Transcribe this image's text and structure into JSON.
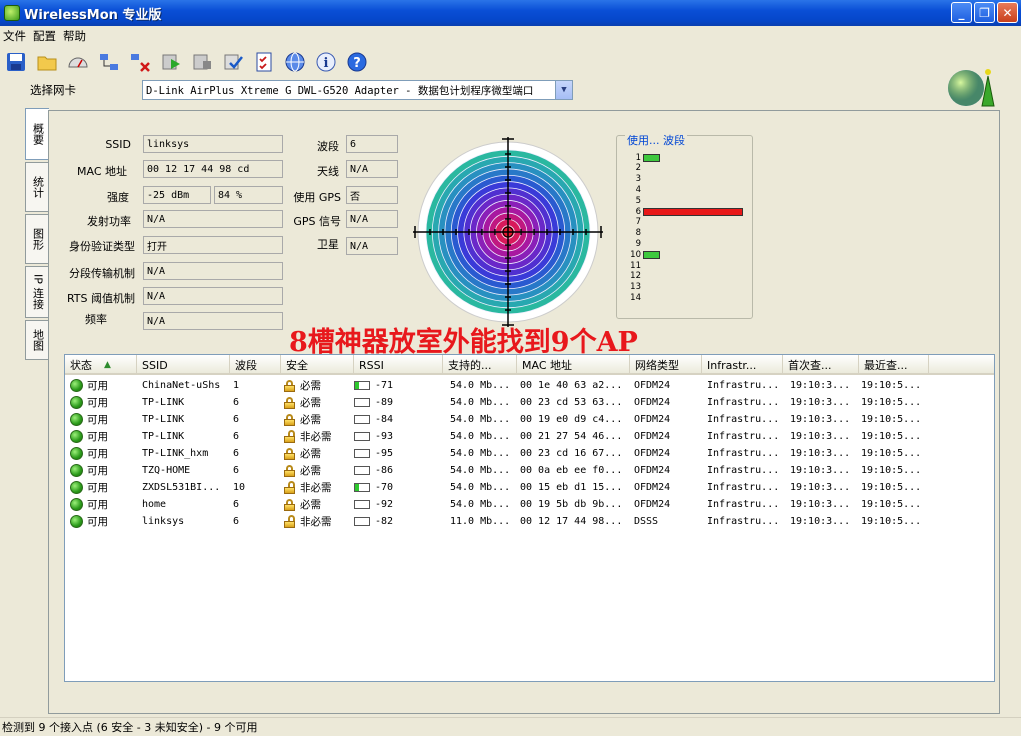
{
  "window": {
    "title": "WirelessMon 专业版"
  },
  "menu": [
    "文件",
    "配置",
    "帮助"
  ],
  "toolbar": [
    "save-icon",
    "open-folder-icon",
    "speedometer-icon",
    "network-icon",
    "disconnect-icon",
    "run-icon",
    "stop-icon",
    "check-icon",
    "checklist-icon",
    "globe-icon",
    "info-icon",
    "help-icon"
  ],
  "adapter": {
    "label": "选择网卡",
    "value": "D-Link AirPlus Xtreme G DWL-G520 Adapter - 数据包计划程序微型端口"
  },
  "tabs": [
    "概要",
    "统计",
    "图形",
    "IP 连接",
    "地图"
  ],
  "summary": {
    "ssid_label": "SSID",
    "ssid": "linksys",
    "mac_label": "MAC 地址",
    "mac": "00 12 17 44 98 cd",
    "strength_label": "强度",
    "strength_dbm": "-25 dBm",
    "strength_pct": "84 %",
    "tx_label": "发射功率",
    "tx": "N/A",
    "auth_label": "身份验证类型",
    "auth": "打开",
    "frag_label": "分段传输机制",
    "frag": "N/A",
    "rts_label": "RTS 阈值机制",
    "rts": "N/A",
    "freq_label": "频率",
    "freq": "N/A",
    "channel_label": "波段",
    "channel": "6",
    "antenna_label": "天线",
    "antenna": "N/A",
    "gps_label": "使用 GPS",
    "gps": "否",
    "gps_signal_label": "GPS 信号",
    "gps_signal": "N/A",
    "satellite_label": "卫星",
    "satellite": "N/A"
  },
  "channel_usage": {
    "title": "使用... 波段",
    "channels": [
      "1",
      "2",
      "3",
      "4",
      "5",
      "6",
      "7",
      "8",
      "9",
      "10",
      "11",
      "12",
      "13",
      "14"
    ],
    "usage": [
      1,
      0,
      0,
      0,
      0,
      6,
      0,
      0,
      0,
      1,
      0,
      0,
      0,
      0
    ],
    "colors": {
      "low": "#3ec83e",
      "high": "#e81818"
    }
  },
  "table": {
    "columns": [
      "状态",
      "SSID",
      "波段",
      "安全",
      "RSSI",
      "支持的...",
      "MAC 地址",
      "网络类型",
      "Infrastr...",
      "首次查...",
      "最近查..."
    ],
    "rows": [
      {
        "status": "可用",
        "ssid": "ChinaNet-uShs",
        "channel": "1",
        "lock": "closed",
        "security": "必需",
        "rssi_fill": 0.25,
        "rssi": "-71",
        "rates": "54.0 Mb...",
        "mac": "00 1e 40 63 a2...",
        "net": "OFDM24",
        "infra": "Infrastru...",
        "first": "19:10:3...",
        "last": "19:10:5..."
      },
      {
        "status": "可用",
        "ssid": "TP-LINK",
        "channel": "6",
        "lock": "closed",
        "security": "必需",
        "rssi_fill": 0,
        "rssi": "-89",
        "rates": "54.0 Mb...",
        "mac": "00 23 cd 53 63...",
        "net": "OFDM24",
        "infra": "Infrastru...",
        "first": "19:10:3...",
        "last": "19:10:5..."
      },
      {
        "status": "可用",
        "ssid": "TP-LINK",
        "channel": "6",
        "lock": "closed",
        "security": "必需",
        "rssi_fill": 0,
        "rssi": "-84",
        "rates": "54.0 Mb...",
        "mac": "00 19 e0 d9 c4...",
        "net": "OFDM24",
        "infra": "Infrastru...",
        "first": "19:10:3...",
        "last": "19:10:5..."
      },
      {
        "status": "可用",
        "ssid": "TP-LINK",
        "channel": "6",
        "lock": "open",
        "security": "非必需",
        "rssi_fill": 0,
        "rssi": "-93",
        "rates": "54.0 Mb...",
        "mac": "00 21 27 54 46...",
        "net": "OFDM24",
        "infra": "Infrastru...",
        "first": "19:10:3...",
        "last": "19:10:5..."
      },
      {
        "status": "可用",
        "ssid": "TP-LINK_hxm",
        "channel": "6",
        "lock": "closed",
        "security": "必需",
        "rssi_fill": 0,
        "rssi": "-95",
        "rates": "54.0 Mb...",
        "mac": "00 23 cd 16 67...",
        "net": "OFDM24",
        "infra": "Infrastru...",
        "first": "19:10:3...",
        "last": "19:10:5..."
      },
      {
        "status": "可用",
        "ssid": "TZQ-HOME",
        "channel": "6",
        "lock": "closed",
        "security": "必需",
        "rssi_fill": 0,
        "rssi": "-86",
        "rates": "54.0 Mb...",
        "mac": "00 0a eb ee f0...",
        "net": "OFDM24",
        "infra": "Infrastru...",
        "first": "19:10:3...",
        "last": "19:10:5..."
      },
      {
        "status": "可用",
        "ssid": "ZXDSL531BI...",
        "channel": "10",
        "lock": "open",
        "security": "非必需",
        "rssi_fill": 0.25,
        "rssi": "-70",
        "rates": "54.0 Mb...",
        "mac": "00 15 eb d1 15...",
        "net": "OFDM24",
        "infra": "Infrastru...",
        "first": "19:10:3...",
        "last": "19:10:5..."
      },
      {
        "status": "可用",
        "ssid": "home",
        "channel": "6",
        "lock": "closed",
        "security": "必需",
        "rssi_fill": 0,
        "rssi": "-92",
        "rates": "54.0 Mb...",
        "mac": "00 19 5b db 9b...",
        "net": "OFDM24",
        "infra": "Infrastru...",
        "first": "19:10:3...",
        "last": "19:10:5..."
      },
      {
        "status": "可用",
        "ssid": "linksys",
        "channel": "6",
        "lock": "open",
        "security": "非必需",
        "rssi_fill": 0,
        "rssi": "-82",
        "rates": "11.0 Mb...",
        "mac": "00 12 17 44 98...",
        "net": "DSSS",
        "infra": "Infrastru...",
        "first": "19:10:3...",
        "last": "19:10:5..."
      }
    ]
  },
  "overlay_text": "8槽神器放室外能找到9个AP",
  "status": "检测到 9 个接入点 (6 安全 - 3 未知安全) - 9 个可用"
}
